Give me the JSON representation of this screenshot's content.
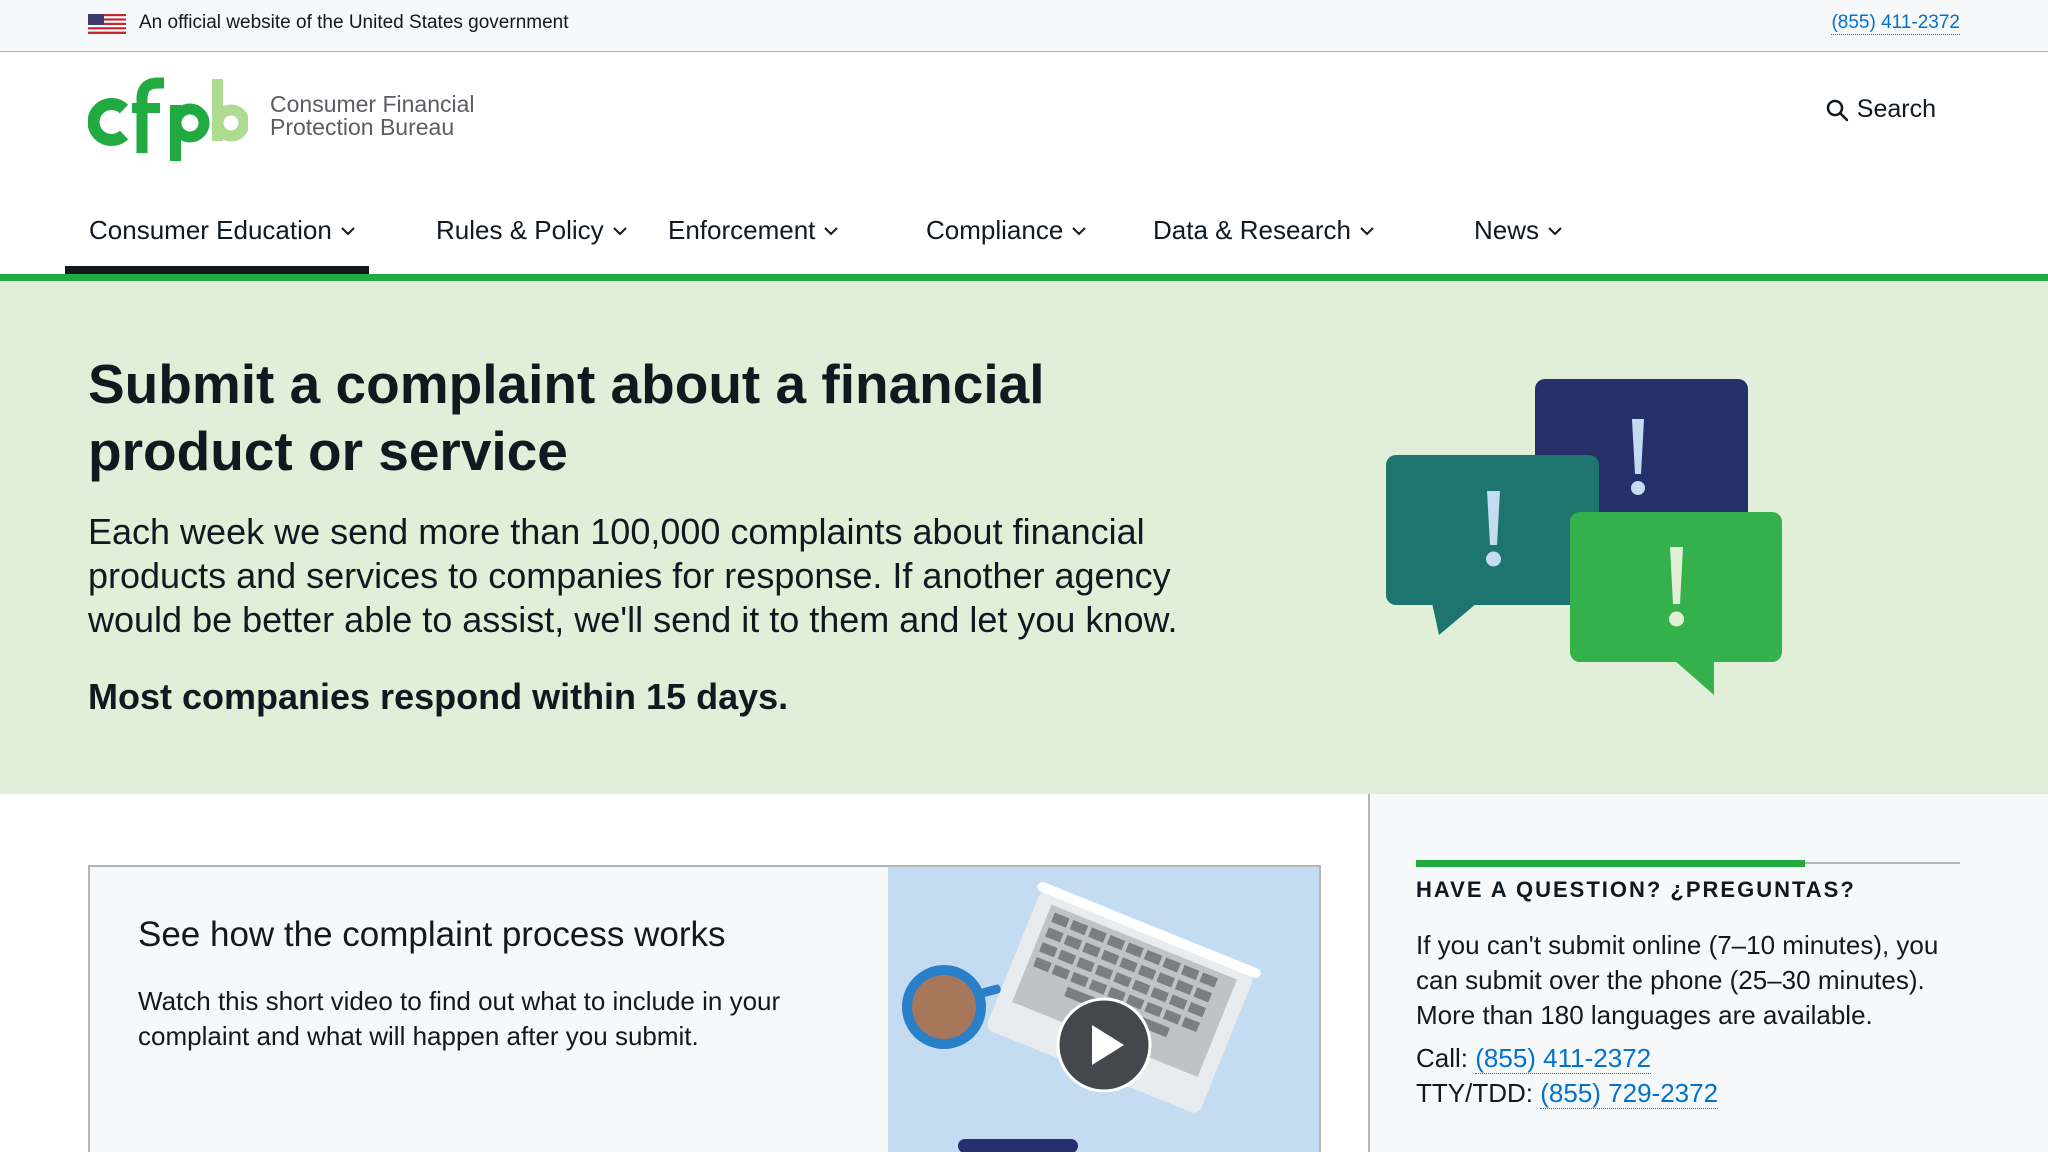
{
  "gov_banner": {
    "text": "An official website of the United States government",
    "phone": "(855) 411-2372"
  },
  "header": {
    "logo_line1": "Consumer Financial",
    "logo_line2": "Protection Bureau",
    "logo_lettering": "cfpb",
    "search_label": "Search"
  },
  "nav": {
    "items": [
      {
        "label": "Consumer Education",
        "active": true
      },
      {
        "label": "Rules & Policy",
        "active": false
      },
      {
        "label": "Enforcement",
        "active": false
      },
      {
        "label": "Compliance",
        "active": false
      },
      {
        "label": "Data & Research",
        "active": false
      },
      {
        "label": "News",
        "active": false
      }
    ]
  },
  "hero": {
    "title": "Submit a complaint about a financial product or service",
    "lead": "Each week we send more than 100,000 complaints about financial products and services to companies for response. If another agency would be better able to assist, we'll send it to them and let you know.",
    "note": "Most companies respond within 15 days."
  },
  "video_card": {
    "title": "See how the complaint process works",
    "body": "Watch this short video to find out what to include in your complaint and what will happen after you submit."
  },
  "sidebar": {
    "heading": "HAVE A QUESTION? ¿PREGUNTAS?",
    "body": "If you can't submit online (7–10 minutes), you can submit over the phone (25–30 minutes). More than 180 languages are available.",
    "call_label": "Call:",
    "call_phone": "(855) 411-2372",
    "tty_label": "TTY/TDD:",
    "tty_phone": "(855) 729-2372"
  },
  "colors": {
    "brand_green": "#20aa3f",
    "light_green_bg": "#e2efd8",
    "navy": "#25306b",
    "teal": "#1e746f",
    "link_blue": "#0072ce",
    "text": "#101820"
  },
  "icons": [
    "us-flag-icon",
    "cfpb-logo",
    "search-icon",
    "chevron-down-icon",
    "speech-bubbles-alert-illustration",
    "play-icon"
  ]
}
